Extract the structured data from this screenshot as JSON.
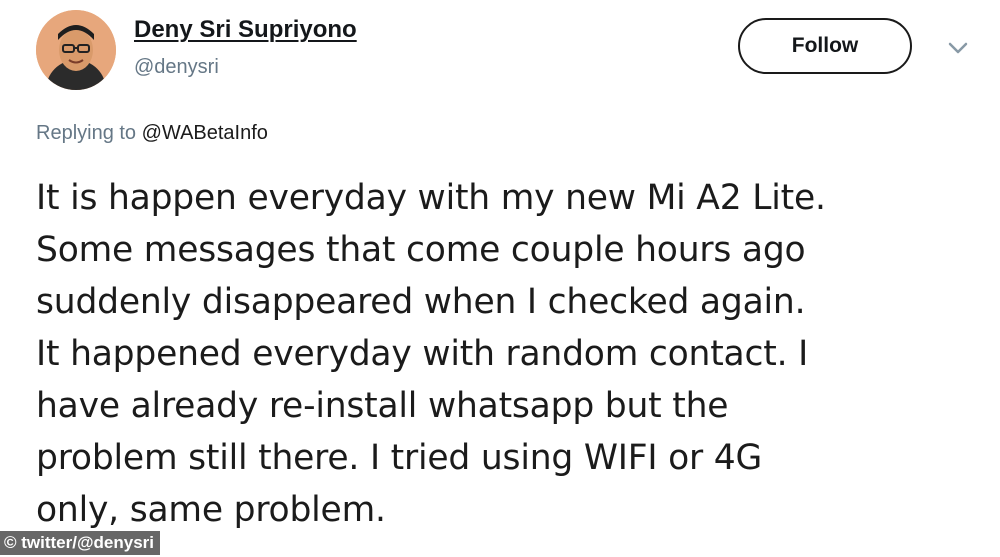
{
  "author": {
    "name": "Deny Sri Supriyono",
    "handle": "@denysri",
    "avatar_icon": "user-photo-icon"
  },
  "actions": {
    "follow_label": "Follow",
    "more_icon": "chevron-down-icon"
  },
  "reply_context": {
    "prefix": "Replying to",
    "mention": "@WABetaInfo"
  },
  "tweet": {
    "lines": [
      "It is happen everyday with my new Mi A2 Lite.",
      "Some messages that come couple hours ago",
      "suddenly disappeared when I checked again.",
      "It happened everyday with random contact. I",
      "have already re-install whatsapp but the",
      "problem still there. I tried using WIFI or 4G",
      "only, same problem."
    ]
  },
  "credit": "© twitter/@denysri",
  "colors": {
    "text": "#14171a",
    "muted": "#657786",
    "button_border": "#1a1a1a",
    "credit_bg": "#3c3c3c"
  }
}
